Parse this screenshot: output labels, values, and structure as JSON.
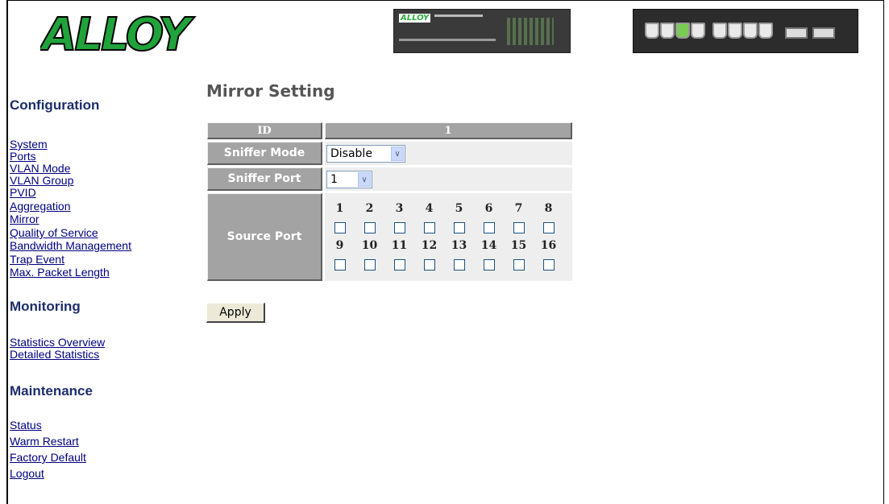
{
  "header": {
    "logo_text": "ALLOY",
    "device_label": "ALLOY"
  },
  "sidebar": {
    "sections": [
      {
        "title": "Configuration",
        "items": [
          "System",
          "Ports",
          "VLAN Mode",
          "VLAN Group",
          "PVID",
          "Aggregation",
          "Mirror",
          "Quality of Service",
          "Bandwidth Management",
          "Trap Event",
          "Max. Packet Length"
        ]
      },
      {
        "title": "Monitoring",
        "items": [
          "Statistics Overview",
          "Detailed Statistics"
        ]
      },
      {
        "title": "Maintenance",
        "items": [
          "Status",
          "Warm Restart",
          "Factory Default",
          "Logout"
        ]
      }
    ]
  },
  "main": {
    "title": "Mirror Setting",
    "table": {
      "id_header": "ID",
      "id_value": "1",
      "sniffer_mode_label": "Sniffer Mode",
      "sniffer_mode_value": "Disable",
      "sniffer_port_label": "Sniffer Port",
      "sniffer_port_value": "1",
      "source_port_label": "Source Port",
      "ports_row1": [
        "1",
        "2",
        "3",
        "4",
        "5",
        "6",
        "7",
        "8"
      ],
      "ports_row2": [
        "9",
        "10",
        "11",
        "12",
        "13",
        "14",
        "15",
        "16"
      ]
    },
    "apply_label": "Apply"
  },
  "colors": {
    "header_cell": "#a3a3a3",
    "value_cell": "#eeeeee",
    "logo_green": "#1fa33a",
    "nav_link": "#000080",
    "section_title": "#1d2d6b"
  }
}
